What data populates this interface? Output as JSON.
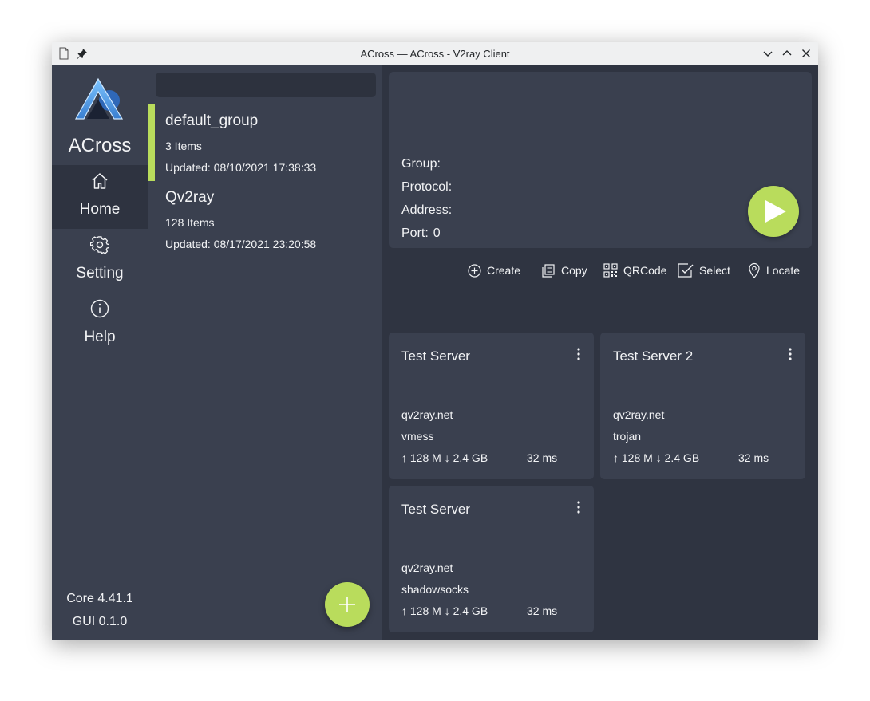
{
  "window": {
    "title": "ACross — ACross - V2ray Client"
  },
  "nav": {
    "app_name": "ACross",
    "items": [
      {
        "label": "Home",
        "icon": "home-icon"
      },
      {
        "label": "Setting",
        "icon": "gear-icon"
      },
      {
        "label": "Help",
        "icon": "info-icon"
      }
    ],
    "core_version": "Core 4.41.1",
    "gui_version": "GUI 0.1.0"
  },
  "groups": {
    "search_value": "",
    "list": [
      {
        "name": "default_group",
        "count": "3 Items",
        "updated": "Updated: 08/10/2021 17:38:33",
        "selected": true
      },
      {
        "name": "Qv2ray",
        "count": "128 Items",
        "updated": "Updated: 08/17/2021 23:20:58",
        "selected": false
      }
    ]
  },
  "detail": {
    "group_label": "Group:",
    "group_value": "",
    "protocol_label": "Protocol:",
    "protocol_value": "",
    "address_label": "Address:",
    "address_value": "",
    "port_label": "Port:",
    "port_value": "0"
  },
  "toolbar": {
    "create": "Create",
    "copy": "Copy",
    "qrcode": "QRCode",
    "select": "Select",
    "locate": "Locate"
  },
  "servers": [
    {
      "name": "Test Server",
      "address": "qv2ray.net",
      "protocol": "vmess",
      "traffic": "↑ 128 M ↓ 2.4 GB",
      "latency": "32 ms"
    },
    {
      "name": "Test Server 2",
      "address": "qv2ray.net",
      "protocol": "trojan",
      "traffic": "↑ 128 M ↓ 2.4 GB",
      "latency": "32 ms"
    },
    {
      "name": "Test Server",
      "address": "qv2ray.net",
      "protocol": "shadowsocks",
      "traffic": "↑ 128 M ↓ 2.4 GB",
      "latency": "32 ms"
    }
  ],
  "colors": {
    "accent": "#b9dc5c",
    "panel": "#3a404f",
    "background": "#2f3441",
    "text": "#f2f3f5"
  }
}
